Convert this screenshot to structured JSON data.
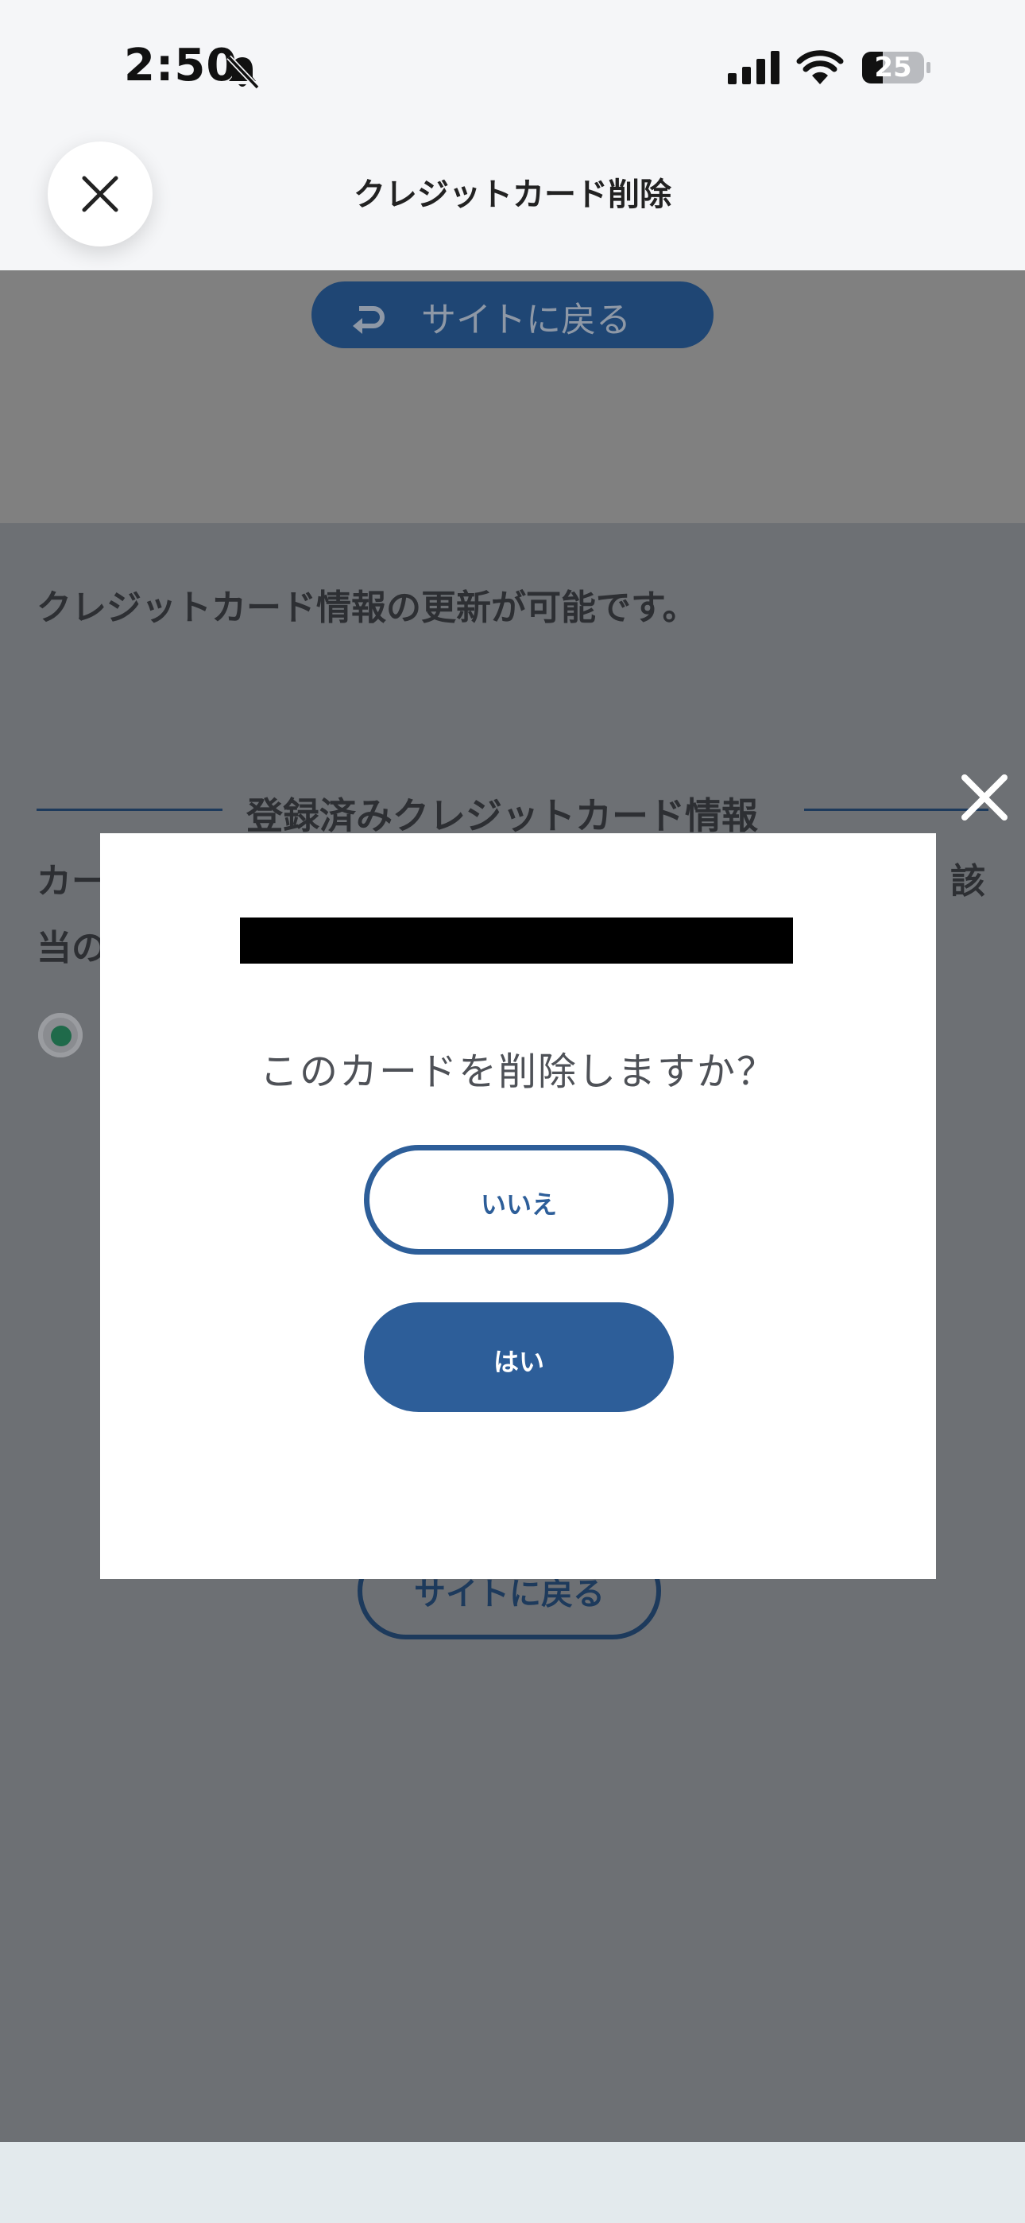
{
  "status_bar": {
    "time": "2:50",
    "battery": "25"
  },
  "header": {
    "title": "クレジットカード削除"
  },
  "page": {
    "back_to_site_top": "サイトに戻る",
    "info_text": "クレジットカード情報の更新が可能です。",
    "section_title": "登録済みクレジットカード情報",
    "text_fragment_1": "カー",
    "text_fragment_2": "当の",
    "text_fragment_3": "該",
    "back_to_site_bottom": "サイトに戻る"
  },
  "modal": {
    "question": "このカードを削除しますか？",
    "no_label": "いいえ",
    "yes_label": "はい"
  },
  "colors": {
    "accent": "#2d5e99",
    "overlay": "#6d7074",
    "radio_selected": "#1f6a4a"
  }
}
